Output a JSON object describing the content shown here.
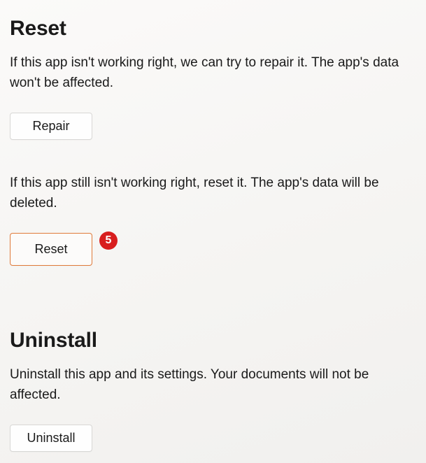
{
  "reset": {
    "title": "Reset",
    "repair_desc": "If this app isn't working right, we can try to repair it. The app's data won't be affected.",
    "repair_label": "Repair",
    "reset_desc": "If this app still isn't working right, reset it. The app's data will be deleted.",
    "reset_label": "Reset",
    "step_badge": "5"
  },
  "uninstall": {
    "title": "Uninstall",
    "desc": "Uninstall this app and its settings. Your documents will not be affected.",
    "uninstall_label": "Uninstall"
  }
}
